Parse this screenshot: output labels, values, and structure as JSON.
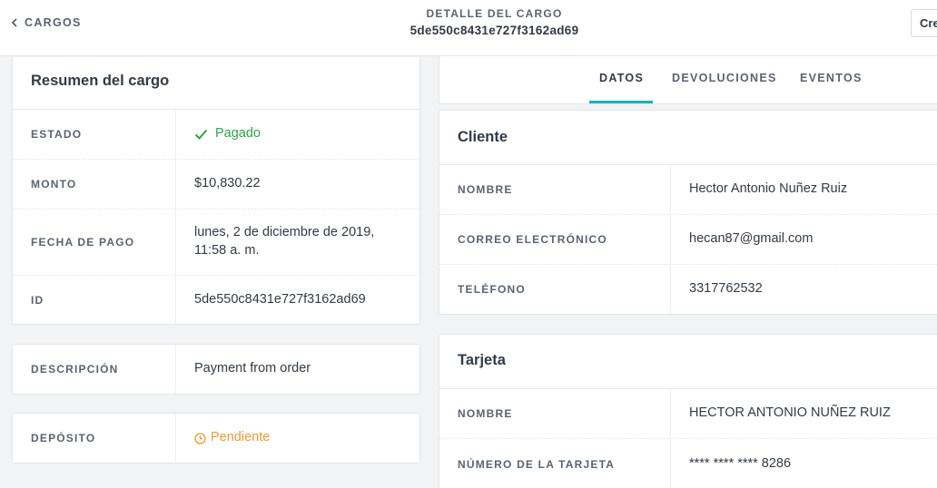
{
  "nav": {
    "back_label": "CARGOS",
    "create_label": "Cre"
  },
  "header": {
    "supertitle": "DETALLE DEL CARGO",
    "charge_id": "5de550c8431e727f3162ad69"
  },
  "summary": {
    "title": "Resumen del cargo",
    "rows": [
      {
        "label": "ESTADO",
        "value": "Pagado"
      },
      {
        "label": "MONTO",
        "value": "$10,830.22"
      },
      {
        "label": "FECHA DE PAGO",
        "value": "lunes, 2 de diciembre de 2019, 11:58 a. m."
      },
      {
        "label": "ID",
        "value": "5de550c8431e727f3162ad69"
      }
    ]
  },
  "description": {
    "label": "DESCRIPCIÓN",
    "value": "Payment from order"
  },
  "deposit": {
    "label": "DEPÓSITO",
    "value": "Pendiente"
  },
  "tabs": [
    {
      "label": "DATOS",
      "active": true
    },
    {
      "label": "DEVOLUCIONES",
      "active": false
    },
    {
      "label": "EVENTOS",
      "active": false
    }
  ],
  "client": {
    "title": "Cliente",
    "rows": [
      {
        "label": "NOMBRE",
        "value": "Hector Antonio Nuñez Ruiz"
      },
      {
        "label": "CORREO ELECTRÓNICO",
        "value": "hecan87@gmail.com"
      },
      {
        "label": "TELÉFONO",
        "value": "3317762532"
      }
    ]
  },
  "card": {
    "title": "Tarjeta",
    "rows": [
      {
        "label": "NOMBRE",
        "value": "HECTOR ANTONIO NUÑEZ RUIZ"
      },
      {
        "label": "NÚMERO DE LA TARJETA",
        "value": "**** **** **** 8286"
      }
    ]
  },
  "colors": {
    "accent": "#1bb3b8",
    "success": "#2ea34b",
    "pending": "#eb9a36"
  }
}
